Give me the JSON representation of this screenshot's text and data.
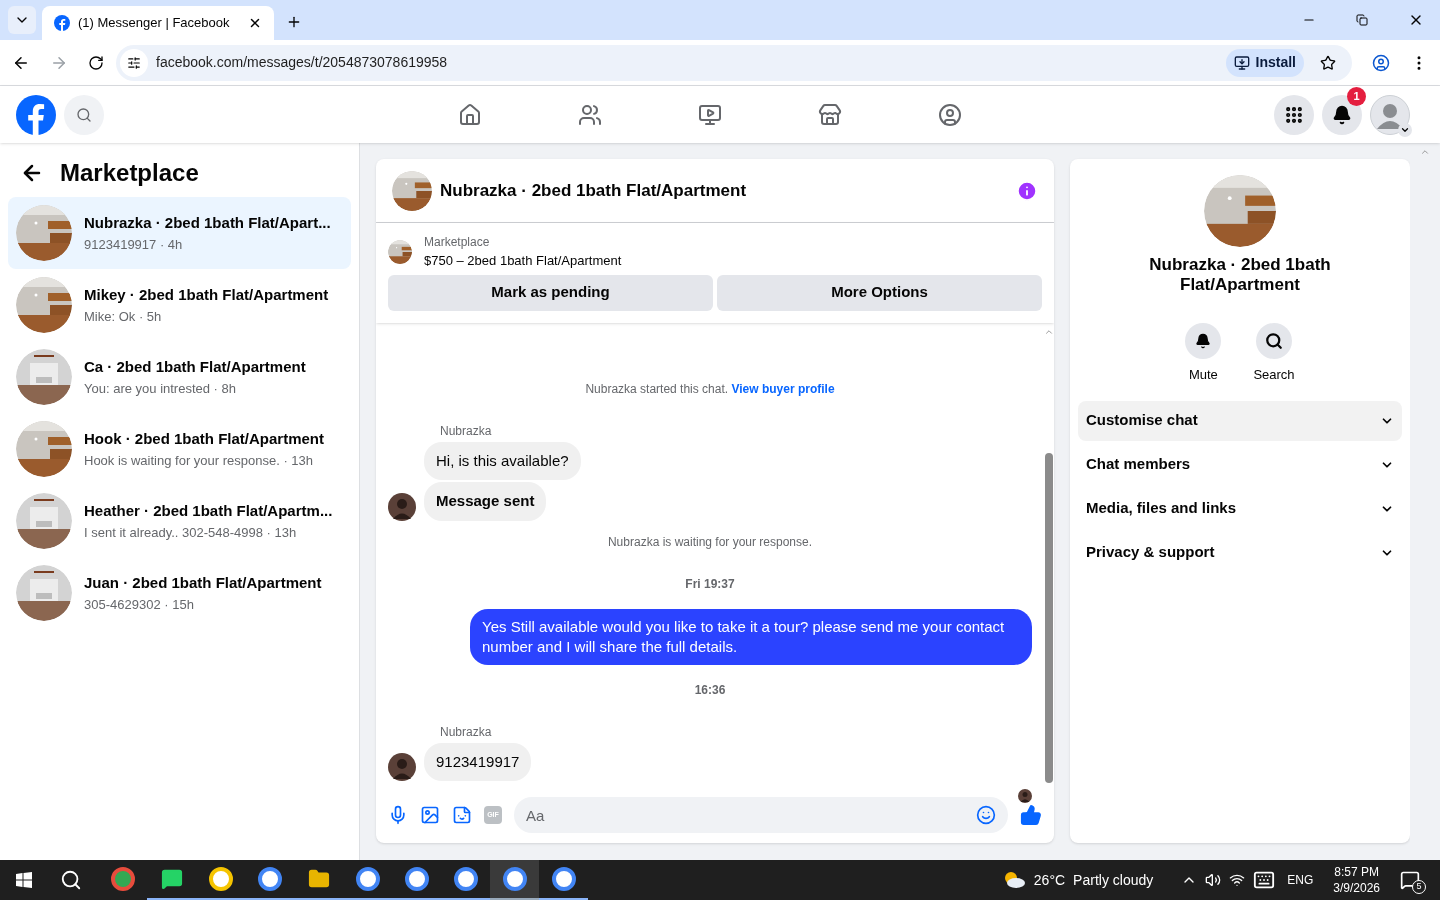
{
  "browser": {
    "tab_title": "(1) Messenger | Facebook",
    "url": "facebook.com/messages/t/2054873078619958",
    "install_label": "Install"
  },
  "header": {
    "notification_count": "1",
    "nav": [
      {
        "kind": "home",
        "selected": false
      },
      {
        "kind": "friends",
        "selected": false
      },
      {
        "kind": "video",
        "selected": false
      },
      {
        "kind": "marketplace",
        "selected": false
      },
      {
        "kind": "groups",
        "selected": false
      }
    ]
  },
  "sidebar": {
    "title": "Marketplace",
    "chats": [
      {
        "title": "Nubrazka · 2bed 1bath Flat/Apart...",
        "preview": "9123419917 · 4h",
        "selected": true
      },
      {
        "title": "Mikey · 2bed 1bath Flat/Apartment",
        "preview": "Mike: Ok · 5h",
        "selected": false
      },
      {
        "title": "Ca · 2bed 1bath Flat/Apartment",
        "preview": "You: are you intrested · 8h",
        "selected": false
      },
      {
        "title": "Hook · 2bed 1bath Flat/Apartment",
        "preview": "Hook is waiting for your response. · 13h",
        "selected": false
      },
      {
        "title": "Heather · 2bed 1bath Flat/Apartm...",
        "preview": "I sent it already.. 302-548-4998 · 13h",
        "selected": false
      },
      {
        "title": "Juan · 2bed 1bath Flat/Apartment",
        "preview": "305-4629302 · 15h",
        "selected": false
      }
    ]
  },
  "chat": {
    "title": "Nubrazka · 2bed 1bath Flat/Apartment",
    "listing_label": "Marketplace",
    "listing": "$750 – 2bed 1bath Flat/Apartment",
    "buttons": [
      "Mark as pending",
      "More Options"
    ],
    "messages": [
      {
        "kind": "notice",
        "text": "Nubrazka started this chat.",
        "link": "View buyer profile"
      },
      {
        "kind": "sender",
        "text": "Nubrazka"
      },
      {
        "kind": "incoming",
        "text": "Hi, is this available?",
        "avatar": false,
        "bold": false
      },
      {
        "kind": "incoming",
        "text": "Message sent",
        "avatar": true,
        "bold": true
      },
      {
        "kind": "notice",
        "text": "Nubrazka is waiting for your response."
      },
      {
        "kind": "time",
        "text": "Fri 19:37"
      },
      {
        "kind": "outgoing",
        "text": "Yes Still available would you like to take it a tour? please send me your contact number and I will share the full details."
      },
      {
        "kind": "time",
        "text": "16:36"
      },
      {
        "kind": "sender",
        "text": "Nubrazka"
      },
      {
        "kind": "incoming",
        "text": "9123419917",
        "avatar": true,
        "bold": false
      }
    ],
    "composer": {
      "placeholder": "Aa",
      "gif_label": "GIF"
    }
  },
  "details": {
    "title": "Nubrazka · 2bed 1bath Flat/Apartment",
    "actions": [
      "Mute",
      "Search"
    ],
    "sections": [
      {
        "label": "Customise chat",
        "selected": true
      },
      {
        "label": "Chat members",
        "selected": false
      },
      {
        "label": "Media, files and links",
        "selected": false
      },
      {
        "label": "Privacy & support",
        "selected": false
      }
    ]
  },
  "taskbar": {
    "weather_temp": "26°C",
    "weather_text": "Partly cloudy",
    "language": "ENG",
    "time": "8:57 PM",
    "date": "3/9/2026",
    "notification_count": "5"
  }
}
